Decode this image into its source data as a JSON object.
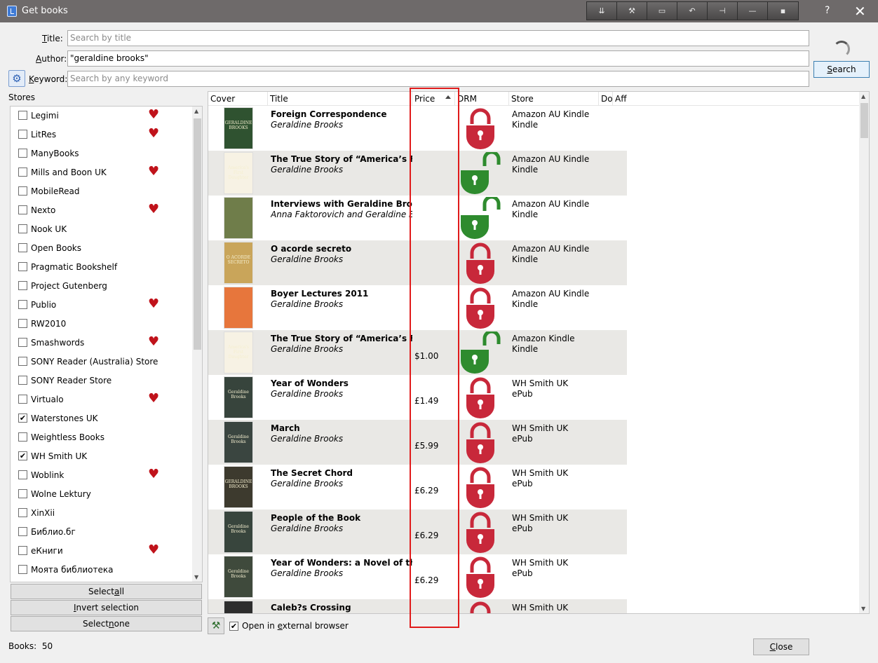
{
  "window": {
    "title": "Get books",
    "help": "?",
    "close": "✕"
  },
  "toolbar_tools": [
    "⇊",
    "⚒",
    "▭",
    "↶",
    "⊣",
    "—",
    "▪"
  ],
  "form": {
    "title_label_u": "T",
    "title_label_rest": "itle:",
    "title_placeholder": "Search by title",
    "author_label_u": "A",
    "author_label_rest": "uthor:",
    "author_value": "\"geraldine brooks\"",
    "keyword_label_u": "K",
    "keyword_label_rest": "eyword:",
    "keyword_placeholder": "Search by any keyword",
    "search_u": "S",
    "search_rest": "earch"
  },
  "stores": {
    "title": "Stores",
    "items": [
      {
        "name": "Legimi",
        "checked": false,
        "fav": true
      },
      {
        "name": "LitRes",
        "checked": false,
        "fav": true
      },
      {
        "name": "ManyBooks",
        "checked": false,
        "fav": false
      },
      {
        "name": "Mills and Boon UK",
        "checked": false,
        "fav": true
      },
      {
        "name": "MobileRead",
        "checked": false,
        "fav": false
      },
      {
        "name": "Nexto",
        "checked": false,
        "fav": true
      },
      {
        "name": "Nook UK",
        "checked": false,
        "fav": false
      },
      {
        "name": "Open Books",
        "checked": false,
        "fav": false
      },
      {
        "name": "Pragmatic Bookshelf",
        "checked": false,
        "fav": false
      },
      {
        "name": "Project Gutenberg",
        "checked": false,
        "fav": false
      },
      {
        "name": "Publio",
        "checked": false,
        "fav": true
      },
      {
        "name": "RW2010",
        "checked": false,
        "fav": false
      },
      {
        "name": "Smashwords",
        "checked": false,
        "fav": true
      },
      {
        "name": "SONY Reader (Australia) Store",
        "checked": false,
        "fav": false
      },
      {
        "name": "SONY Reader Store",
        "checked": false,
        "fav": false
      },
      {
        "name": "Virtualo",
        "checked": false,
        "fav": true
      },
      {
        "name": "Waterstones UK",
        "checked": true,
        "fav": false
      },
      {
        "name": "Weightless Books",
        "checked": false,
        "fav": false
      },
      {
        "name": "WH Smith UK",
        "checked": true,
        "fav": false
      },
      {
        "name": "Woblink",
        "checked": false,
        "fav": true
      },
      {
        "name": "Wolne Lektury",
        "checked": false,
        "fav": false
      },
      {
        "name": "XinXii",
        "checked": false,
        "fav": false
      },
      {
        "name": "Библио.бг",
        "checked": false,
        "fav": false
      },
      {
        "name": "еКниги",
        "checked": false,
        "fav": true
      },
      {
        "name": "Моята библиотека",
        "checked": false,
        "fav": false
      }
    ],
    "select_all_u": "a",
    "select_all_pre": "Select ",
    "select_all_post": "ll",
    "invert_u": "I",
    "invert_rest": "nvert selection",
    "select_none_pre": "Select ",
    "select_none_u": "n",
    "select_none_post": "one"
  },
  "table": {
    "columns": [
      "Cover",
      "Title",
      "Price",
      "DRM",
      "Store",
      "Do",
      "Aff"
    ],
    "rows": [
      {
        "title": "Foreign Correspondence",
        "author": "Geraldine Brooks",
        "price": "",
        "drm": "locked",
        "store": "Amazon AU Kindle",
        "format": "Kindle",
        "cover_color": "#2f5230",
        "cover_text": "GERALDINE BROOKS"
      },
      {
        "title": "The True Story of “America’s First Da",
        "author": "Geraldine Brooks",
        "price": "",
        "drm": "unlocked",
        "store": "Amazon AU Kindle",
        "format": "Kindle",
        "cover_color": "#f7f2e4",
        "cover_text": "America's First Daughter"
      },
      {
        "title": "Interviews with Geraldine Brooks an",
        "author": "Anna Faktorovich and Geraldine Brook",
        "price": "",
        "drm": "unlocked",
        "store": "Amazon AU Kindle",
        "format": "Kindle",
        "cover_color": "#6f7d4a",
        "cover_text": ""
      },
      {
        "title": "O acorde secreto",
        "author": "Geraldine Brooks",
        "price": "",
        "drm": "locked",
        "store": "Amazon AU Kindle",
        "format": "Kindle",
        "cover_color": "#c9a55a",
        "cover_text": "O ACORDE SECRETO"
      },
      {
        "title": "Boyer Lectures 2011",
        "author": "Geraldine Brooks",
        "price": "",
        "drm": "locked",
        "store": "Amazon AU Kindle",
        "format": "Kindle",
        "cover_color": "#e7763c",
        "cover_text": ""
      },
      {
        "title": "The True Story of “America’s First Da",
        "author": "Geraldine Brooks",
        "price": "$1.00",
        "drm": "unlocked",
        "store": "Amazon Kindle",
        "format": "Kindle",
        "cover_color": "#f7f2e4",
        "cover_text": "America's First Daughter"
      },
      {
        "title": "Year of Wonders",
        "author": "Geraldine Brooks",
        "price": "£1.49",
        "drm": "locked",
        "store": "WH Smith UK",
        "format": "ePub",
        "cover_color": "#37443c",
        "cover_text": "Geraldine Brooks"
      },
      {
        "title": "March",
        "author": "Geraldine Brooks",
        "price": "£5.99",
        "drm": "locked",
        "store": "WH Smith UK",
        "format": "ePub",
        "cover_color": "#3a4540",
        "cover_text": "Geraldine Brooks"
      },
      {
        "title": "The Secret Chord",
        "author": "Geraldine Brooks",
        "price": "£6.29",
        "drm": "locked",
        "store": "WH Smith UK",
        "format": "ePub",
        "cover_color": "#3d3a2e",
        "cover_text": "GERALDINE BROOKS"
      },
      {
        "title": "People of the Book",
        "author": "Geraldine Brooks",
        "price": "£6.29",
        "drm": "locked",
        "store": "WH Smith UK",
        "format": "ePub",
        "cover_color": "#38453d",
        "cover_text": "Geraldine Brooks"
      },
      {
        "title": "Year of Wonders: a Novel of the Plag",
        "author": "Geraldine Brooks",
        "price": "£6.29",
        "drm": "locked",
        "store": "WH Smith UK",
        "format": "ePub",
        "cover_color": "#3f4a3c",
        "cover_text": "Geraldine Brooks"
      },
      {
        "title": "Caleb?s Crossing",
        "author": "",
        "price": "",
        "drm": "locked",
        "store": "WH Smith UK",
        "format": "",
        "cover_color": "#2d2d2d",
        "cover_text": ""
      }
    ]
  },
  "footer": {
    "open_external_pre": "Open in ",
    "open_external_u": "e",
    "open_external_post": "xternal browser",
    "open_external_checked": true,
    "books_label": "Books:",
    "books_count": "50",
    "close_u": "C",
    "close_rest": "lose"
  },
  "colors": {
    "locked": "#c8283a",
    "unlocked": "#2e8b2e",
    "heart": "#c0131b",
    "highlight": "#e01a1a"
  }
}
